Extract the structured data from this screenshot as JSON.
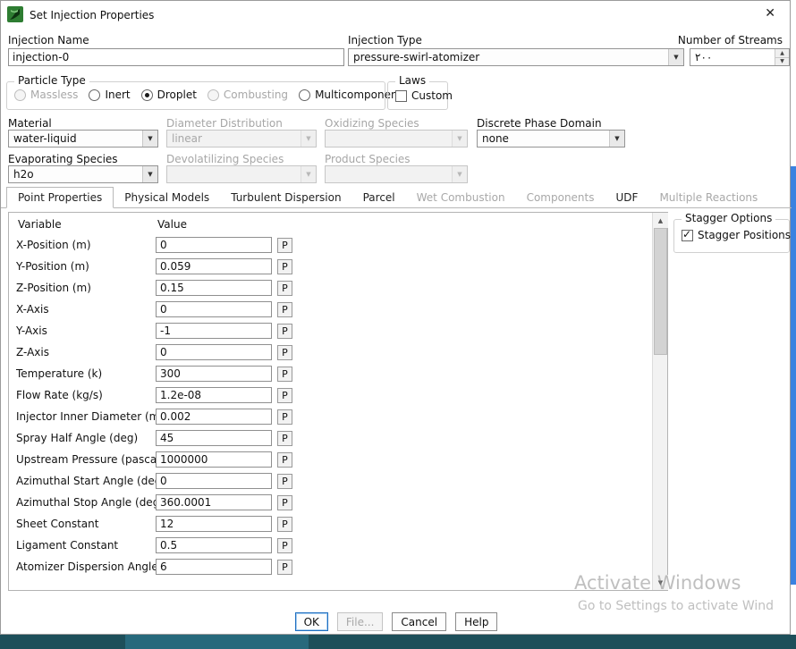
{
  "window": {
    "title": "Set Injection Properties"
  },
  "icons": {
    "close": "✕",
    "arrow_up": "▲",
    "arrow_down": "▼",
    "combo_arrow": "▼",
    "check": "✓"
  },
  "colors": {
    "taskbar_teal": "#1d4f5a",
    "taskbar_teal_light": "#27697c",
    "side_strip_blue": "#3b82e0"
  },
  "header": {
    "injection_name_label": "Injection Name",
    "injection_name_value": "injection-0",
    "injection_type_label": "Injection Type",
    "injection_type_value": "pressure-swirl-atomizer",
    "streams_label": "Number of Streams",
    "streams_value": "٢٠٠"
  },
  "particle_type": {
    "label": "Particle Type",
    "options": [
      {
        "label": "Massless",
        "disabled": true,
        "selected": false
      },
      {
        "label": "Inert",
        "disabled": false,
        "selected": false
      },
      {
        "label": "Droplet",
        "disabled": false,
        "selected": true
      },
      {
        "label": "Combusting",
        "disabled": true,
        "selected": false
      },
      {
        "label": "Multicomponent",
        "disabled": false,
        "selected": false
      }
    ]
  },
  "laws": {
    "label": "Laws",
    "custom_label": "Custom",
    "custom_checked": false
  },
  "selects": {
    "material_label": "Material",
    "material_value": "water-liquid",
    "diameter_label": "Diameter Distribution",
    "diameter_value": "linear",
    "oxidizing_label": "Oxidizing Species",
    "oxidizing_value": "",
    "dpd_label": "Discrete Phase Domain",
    "dpd_value": "none",
    "evap_label": "Evaporating Species",
    "evap_value": "h2o",
    "devol_label": "Devolatilizing Species",
    "devol_value": "",
    "product_label": "Product Species",
    "product_value": ""
  },
  "tabs": [
    {
      "label": "Point Properties",
      "active": true,
      "disabled": false
    },
    {
      "label": "Physical Models",
      "active": false,
      "disabled": false
    },
    {
      "label": "Turbulent Dispersion",
      "active": false,
      "disabled": false
    },
    {
      "label": "Parcel",
      "active": false,
      "disabled": false
    },
    {
      "label": "Wet Combustion",
      "active": false,
      "disabled": true
    },
    {
      "label": "Components",
      "active": false,
      "disabled": true
    },
    {
      "label": "UDF",
      "active": false,
      "disabled": false
    },
    {
      "label": "Multiple Reactions",
      "active": false,
      "disabled": true
    }
  ],
  "table": {
    "variable_header": "Variable",
    "value_header": "Value",
    "p_label": "P",
    "rows": [
      {
        "variable": "X-Position (m)",
        "value": "0"
      },
      {
        "variable": "Y-Position (m)",
        "value": "0.059"
      },
      {
        "variable": "Z-Position (m)",
        "value": "0.15"
      },
      {
        "variable": "X-Axis",
        "value": "0"
      },
      {
        "variable": "Y-Axis",
        "value": "-1"
      },
      {
        "variable": "Z-Axis",
        "value": "0"
      },
      {
        "variable": "Temperature (k)",
        "value": "300"
      },
      {
        "variable": "Flow Rate (kg/s)",
        "value": "1.2e-08"
      },
      {
        "variable": "Injector Inner Diameter (m)",
        "value": "0.002"
      },
      {
        "variable": "Spray Half Angle (deg)",
        "value": "45"
      },
      {
        "variable": "Upstream Pressure (pascal)",
        "value": "1000000"
      },
      {
        "variable": "Azimuthal Start Angle (deg)",
        "value": "0"
      },
      {
        "variable": "Azimuthal Stop Angle (deg)",
        "value": "360.0001"
      },
      {
        "variable": "Sheet Constant",
        "value": "12"
      },
      {
        "variable": "Ligament Constant",
        "value": "0.5"
      },
      {
        "variable": "Atomizer Dispersion Angle",
        "value": "6"
      }
    ]
  },
  "stagger": {
    "title": "Stagger Options",
    "checkbox_label": "Stagger Positions",
    "checked": true
  },
  "footer": {
    "ok": "OK",
    "file": "File...",
    "cancel": "Cancel",
    "help": "Help"
  },
  "watermark": {
    "line1": "Activate Windows",
    "line2": "Go to Settings to activate Wind"
  }
}
